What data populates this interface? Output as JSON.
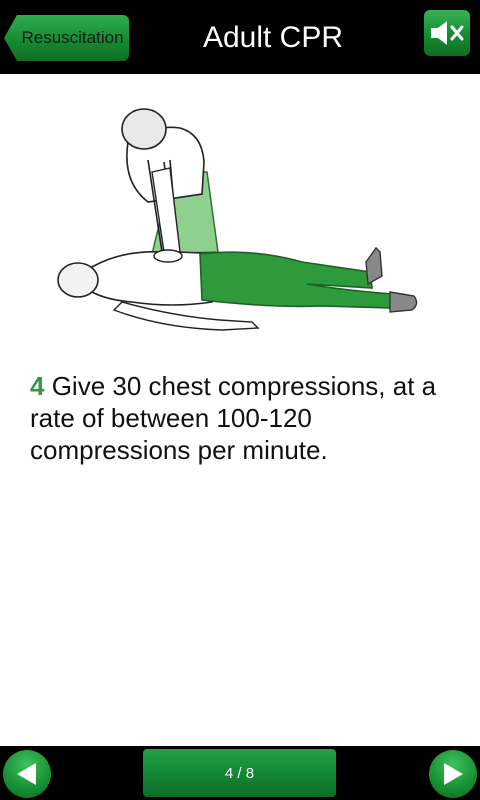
{
  "header": {
    "back_label": "Resuscitation",
    "title": "Adult CPR",
    "sound_icon": "speaker-muted-icon"
  },
  "step": {
    "number": "4",
    "text": "Give 30 chest compressions, at a rate of between 100-120 compressions per minute."
  },
  "footer": {
    "prev_icon": "arrow-left-icon",
    "next_icon": "arrow-right-icon",
    "page_indicator": "4 / 8"
  },
  "colors": {
    "accent_green": "#178a32",
    "step_number_green": "#2f9a3f",
    "bar_background": "#000000"
  }
}
